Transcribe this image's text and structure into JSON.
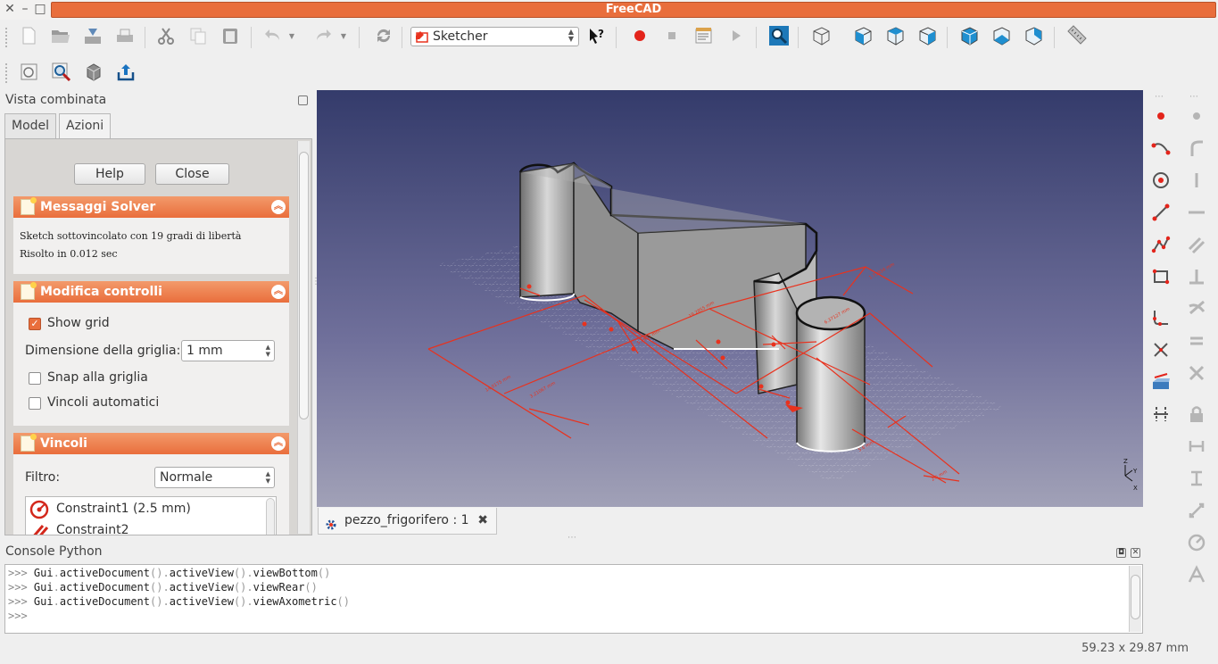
{
  "app": {
    "title": "FreeCAD"
  },
  "toolbar": {
    "workbench": "Sketcher",
    "icons": [
      "new-icon",
      "open-icon",
      "save-icon",
      "print-icon",
      "cut-icon",
      "copy-icon",
      "paste-icon",
      "undo-icon",
      "redo-icon",
      "refresh-icon",
      "whats-this-icon",
      "record-macro-icon",
      "stop-macro-icon",
      "edit-macro-icon",
      "run-macro-icon",
      "fit-all-icon",
      "view-axometric-icon",
      "view-front-icon",
      "view-top-icon",
      "view-right-icon",
      "view-rear-icon",
      "view-bottom-icon",
      "view-left-icon",
      "measure-icon"
    ],
    "row2_icons": [
      "new-sketch-icon",
      "view-sketch-icon",
      "map-sketch-icon",
      "leave-sketch-icon"
    ]
  },
  "combo": {
    "title": "Vista combinata",
    "tabs": [
      "Model",
      "Azioni"
    ],
    "buttons": {
      "help": "Help",
      "close": "Close"
    },
    "solver": {
      "title": "Messaggi Solver",
      "line1": "Sketch sottovincolato con 19 gradi di libertà",
      "line2": "Risolto in 0.012 sec"
    },
    "edit_controls": {
      "title": "Modifica controlli",
      "show_grid": "Show grid",
      "grid_size_label": "Dimensione della griglia:",
      "grid_size_value": "1 mm",
      "snap_grid": "Snap alla griglia",
      "auto_constraints": "Vincoli automatici"
    },
    "constraints": {
      "title": "Vincoli",
      "filter_label": "Filtro:",
      "filter_value": "Normale",
      "items": [
        "Constraint1 (2.5 mm)",
        "Constraint2"
      ]
    }
  },
  "document_tab": {
    "label": "pezzo_frigorifero : 1"
  },
  "console": {
    "title": "Console Python",
    "lines": [
      {
        "prompt": ">>>",
        "a": "Gui",
        "b": "activeDocument",
        "c": "activeView",
        "d": "viewBottom"
      },
      {
        "prompt": ">>>",
        "a": "Gui",
        "b": "activeDocument",
        "c": "activeView",
        "d": "viewRear"
      },
      {
        "prompt": ">>>",
        "a": "Gui",
        "b": "activeDocument",
        "c": "activeView",
        "d": "viewAxometric"
      }
    ],
    "empty_prompt": ">>>"
  },
  "status": {
    "coords": "59.23 x 29.87 mm"
  },
  "colors": {
    "accent": "#e96e3c",
    "constraint_red": "#e8321e",
    "view_top": "#343b6b",
    "view_bottom": "#a1a1b7"
  }
}
